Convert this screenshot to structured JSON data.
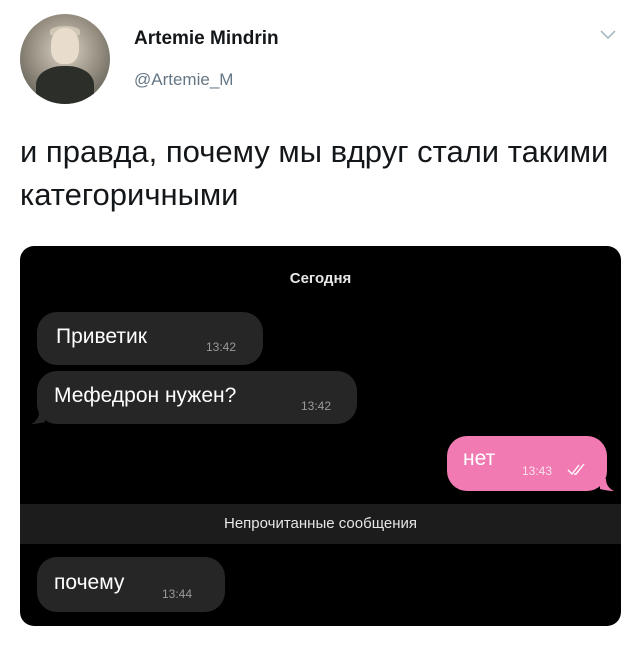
{
  "author": {
    "name": "Artemie Mindrin",
    "handle": "@Artemie_M"
  },
  "icons": {
    "menu": "chevron-down-icon",
    "read_receipt": "double-check-icon"
  },
  "tweet": {
    "text": "и правда, почему мы вдруг стали такими категоричными"
  },
  "chat": {
    "date_label": "Сегодня",
    "unread_label": "Непрочитанные сообщения",
    "messages": [
      {
        "text": "Приветик",
        "time": "13:42",
        "direction": "incoming"
      },
      {
        "text": "Мефедрон нужен?",
        "time": "13:42",
        "direction": "incoming"
      },
      {
        "text": "нет",
        "time": "13:43",
        "direction": "outgoing",
        "read": true
      },
      {
        "text": "почему",
        "time": "13:44",
        "direction": "incoming"
      }
    ],
    "colors": {
      "background": "#000000",
      "incoming_bubble": "#262626",
      "outgoing_bubble": "#f07ab1"
    }
  }
}
